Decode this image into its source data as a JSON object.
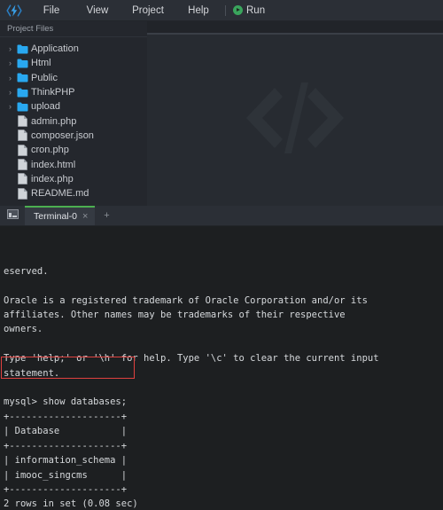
{
  "menubar": {
    "logo_icon": "lightning-code-logo",
    "items": [
      {
        "label": "File",
        "name": "file"
      },
      {
        "label": "View",
        "name": "view"
      },
      {
        "label": "Project",
        "name": "project"
      },
      {
        "label": "Help",
        "name": "help"
      }
    ],
    "run": {
      "label": "Run",
      "icon": "play-circle-icon",
      "color": "#3aa55d"
    }
  },
  "sidebar": {
    "header": "Project Files",
    "tree": [
      {
        "label": "Application",
        "type": "folder",
        "expandable": true,
        "icon": "folder-icon"
      },
      {
        "label": "Html",
        "type": "folder",
        "expandable": true,
        "icon": "folder-icon"
      },
      {
        "label": "Public",
        "type": "folder",
        "expandable": true,
        "icon": "folder-icon"
      },
      {
        "label": "ThinkPHP",
        "type": "folder",
        "expandable": true,
        "icon": "folder-icon"
      },
      {
        "label": "upload",
        "type": "folder",
        "expandable": true,
        "icon": "folder-icon"
      },
      {
        "label": "admin.php",
        "type": "file",
        "expandable": false,
        "icon": "file-icon"
      },
      {
        "label": "composer.json",
        "type": "file",
        "expandable": false,
        "icon": "file-icon"
      },
      {
        "label": "cron.php",
        "type": "file",
        "expandable": false,
        "icon": "file-icon"
      },
      {
        "label": "index.html",
        "type": "file",
        "expandable": false,
        "icon": "file-icon"
      },
      {
        "label": "index.php",
        "type": "file",
        "expandable": false,
        "icon": "file-icon"
      },
      {
        "label": "README.md",
        "type": "file",
        "expandable": false,
        "icon": "file-icon"
      }
    ],
    "caret_glyph": "›",
    "folder_color": "#29a8f0"
  },
  "editor": {
    "watermark_icon": "code-brackets-watermark",
    "watermark_color": "#2e3339"
  },
  "terminal": {
    "panel_icon": "terminal-icon",
    "tab": {
      "label": "Terminal-0",
      "close_glyph": "×",
      "active": true,
      "accent_color": "#4caf50"
    },
    "add_tab_glyph": "+",
    "lines": [
      "eserved.",
      "",
      "Oracle is a registered trademark of Oracle Corporation and/or its",
      "affiliates. Other names may be trademarks of their respective",
      "owners.",
      "",
      "Type 'help;' or '\\h' for help. Type '\\c' to clear the current input",
      "statement.",
      "",
      "mysql> show databases;",
      "+--------------------+",
      "| Database           |",
      "+--------------------+",
      "| information_schema |",
      "| imooc_singcms      |",
      "+--------------------+",
      "2 rows in set (0.08 sec)"
    ],
    "annotation": {
      "name": "highlight-box",
      "target_text": "mysql> show databases;",
      "color": "#e0413f"
    }
  }
}
